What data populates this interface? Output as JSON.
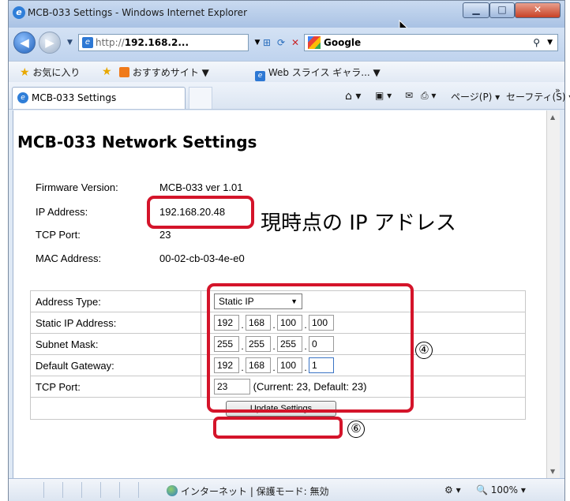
{
  "window": {
    "title": "MCB-033 Settings - Windows Internet Explorer",
    "min_glyph": "▁",
    "max_glyph": "□",
    "close_glyph": "✕"
  },
  "nav": {
    "back_glyph": "◀",
    "forward_glyph": "▶",
    "address_prefix": "http://",
    "address_host": "192.168.2...",
    "search_label": "Google",
    "search_icon_glyph": "⚲"
  },
  "favorites": {
    "favorites_label": "お気に入り",
    "recommended_label": "おすすめサイト ▼",
    "webslice_label": "Web スライス ギャラ... ▼"
  },
  "tabs": {
    "active_label": "MCB-033 Settings",
    "page_menu": "ページ(P) ▾",
    "safety_menu": "セーフティ(S) ▾",
    "overflow": "»"
  },
  "page": {
    "heading": "MCB-033 Network Settings",
    "info": [
      {
        "label": "Firmware Version:",
        "value": "MCB-033 ver 1.01"
      },
      {
        "label": "IP Address:",
        "value": "192.168.20.48"
      },
      {
        "label": "TCP Port:",
        "value": "23"
      },
      {
        "label": "MAC Address:",
        "value": "00-02-cb-03-4e-e0"
      }
    ],
    "annotation_ip": "現時点の IP アドレス",
    "marker_4": "④",
    "marker_6": "⑥"
  },
  "form": {
    "address_type_label": "Address Type:",
    "address_type_value": "Static IP",
    "static_ip_label": "Static IP Address:",
    "static_ip": [
      "192",
      "168",
      "100",
      "100"
    ],
    "subnet_label": "Subnet Mask:",
    "subnet": [
      "255",
      "255",
      "255",
      "0"
    ],
    "gateway_label": "Default Gateway:",
    "gateway": [
      "192",
      "168",
      "100",
      "1"
    ],
    "tcp_label": "TCP Port:",
    "tcp_value": "23",
    "tcp_hint": "(Current: 23, Default: 23)",
    "update_button": "Update Settings"
  },
  "status": {
    "zone_text": "インターネット | 保護モード: 無効",
    "zoom": "100%"
  }
}
